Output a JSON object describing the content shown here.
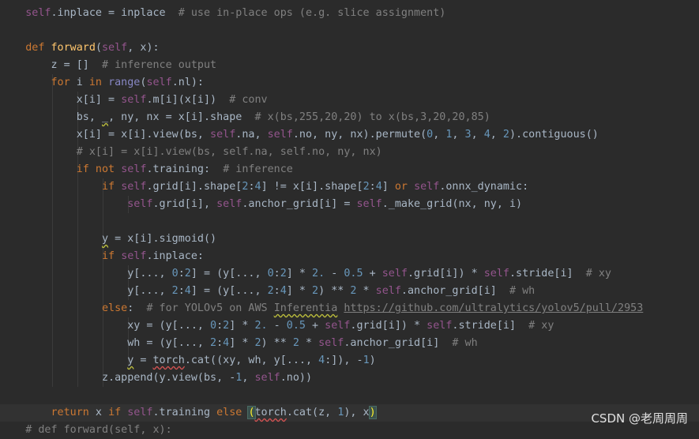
{
  "code_lines": [
    {
      "indent": 2,
      "text": "self.inplace = inplace  # use in-place ops (e.g. slice assignment)"
    },
    {
      "indent": 0,
      "text": ""
    },
    {
      "indent": 1,
      "text": "def forward(self, x):"
    },
    {
      "indent": 2,
      "text": "z = []  # inference output"
    },
    {
      "indent": 2,
      "text": "for i in range(self.nl):"
    },
    {
      "indent": 3,
      "text": "x[i] = self.m[i](x[i])  # conv"
    },
    {
      "indent": 3,
      "text": "bs, _, ny, nx = x[i].shape  # x(bs,255,20,20) to x(bs,3,20,20,85)"
    },
    {
      "indent": 3,
      "text": "x[i] = x[i].view(bs, self.na, self.no, ny, nx).permute(0, 1, 3, 4, 2).contiguous()"
    },
    {
      "indent": 3,
      "text": "# x[i] = x[i].view(bs, self.na, self.no, ny, nx)"
    },
    {
      "indent": 3,
      "text": "if not self.training:  # inference"
    },
    {
      "indent": 4,
      "text": "if self.grid[i].shape[2:4] != x[i].shape[2:4] or self.onnx_dynamic:"
    },
    {
      "indent": 5,
      "text": "self.grid[i], self.anchor_grid[i] = self._make_grid(nx, ny, i)"
    },
    {
      "indent": 0,
      "text": ""
    },
    {
      "indent": 4,
      "text": "y = x[i].sigmoid()"
    },
    {
      "indent": 4,
      "text": "if self.inplace:"
    },
    {
      "indent": 5,
      "text": "y[..., 0:2] = (y[..., 0:2] * 2. - 0.5 + self.grid[i]) * self.stride[i]  # xy"
    },
    {
      "indent": 5,
      "text": "y[..., 2:4] = (y[..., 2:4] * 2) ** 2 * self.anchor_grid[i]  # wh"
    },
    {
      "indent": 4,
      "text": "else:  # for YOLOv5 on AWS Inferentia https://github.com/ultralytics/yolov5/pull/2953"
    },
    {
      "indent": 5,
      "text": "xy = (y[..., 0:2] * 2. - 0.5 + self.grid[i]) * self.stride[i]  # xy"
    },
    {
      "indent": 5,
      "text": "wh = (y[..., 2:4] * 2) ** 2 * self.anchor_grid[i]  # wh"
    },
    {
      "indent": 5,
      "text": "y = torch.cat((xy, wh, y[..., 4:]), -1)"
    },
    {
      "indent": 4,
      "text": "z.append(y.view(bs, -1, self.no))"
    },
    {
      "indent": 0,
      "text": ""
    },
    {
      "indent": 2,
      "text": "return x if self.training else (torch.cat(z, 1), x)"
    },
    {
      "indent": 1,
      "text": "# def forward(self, x):"
    }
  ],
  "watermark": "CSDN @老周周周",
  "colors": {
    "background": "#2b2b2b",
    "keyword": "#cc7832",
    "self": "#94558d",
    "function": "#ffc66d",
    "number": "#6897bb",
    "comment": "#808080"
  }
}
